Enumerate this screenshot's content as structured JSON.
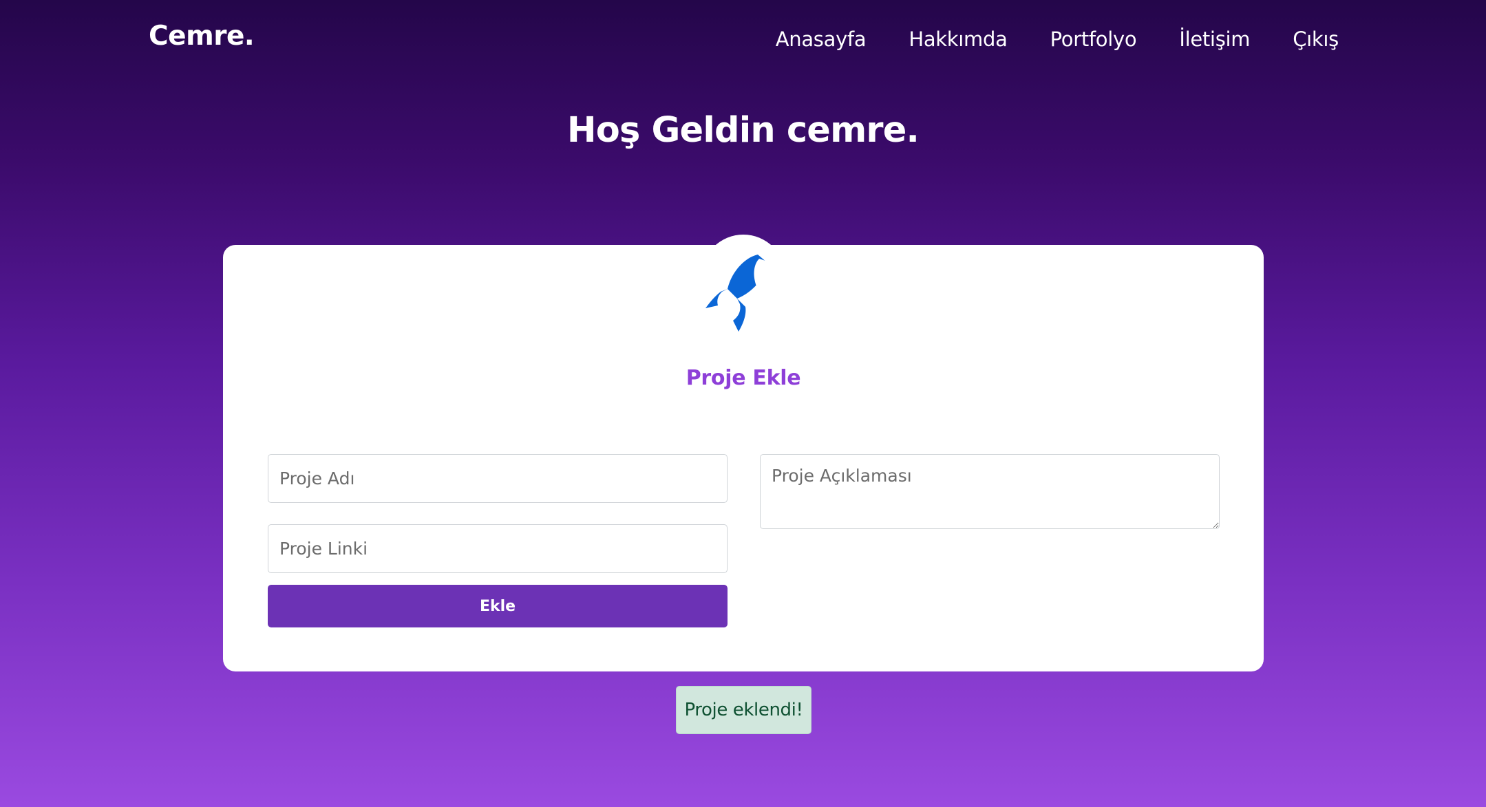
{
  "navbar": {
    "brand": "Cemre.",
    "links": [
      {
        "label": "Anasayfa"
      },
      {
        "label": "Hakkımda"
      },
      {
        "label": "Portfolyo"
      },
      {
        "label": "İletişim"
      },
      {
        "label": "Çıkış"
      }
    ]
  },
  "page": {
    "title": "Hoş Geldin cemre."
  },
  "form": {
    "icon": "rocket-icon",
    "title": "Proje Ekle",
    "name_placeholder": "Proje Adı",
    "link_placeholder": "Proje Linki",
    "description_placeholder": "Proje Açıklaması",
    "submit_label": "Ekle"
  },
  "alert": {
    "message": "Proje eklendi!"
  },
  "colors": {
    "accent": "#8e3fd8",
    "button": "#6c32b5",
    "icon": "#0b66d6",
    "alert_background": "#d1e7dd",
    "alert_text": "#0f5132"
  }
}
